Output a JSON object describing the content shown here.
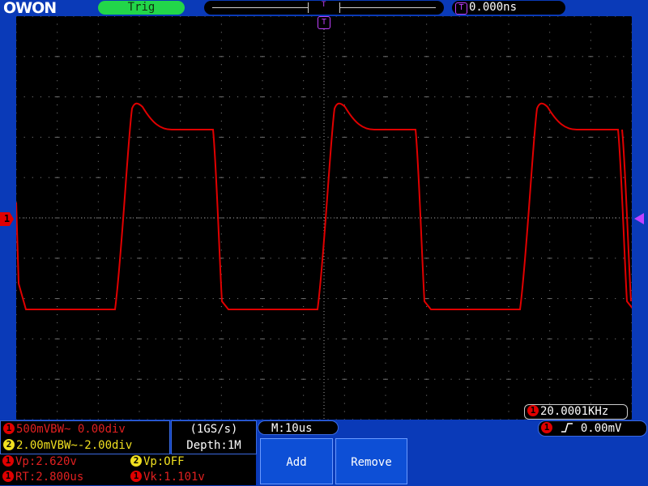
{
  "header": {
    "logo": "OWON",
    "trigger_status": "Trig",
    "timeline_marker": "T",
    "trigger_position_badge": "T",
    "trigger_position": "0.000ns"
  },
  "screen": {
    "ch1_marker": "1",
    "trigger_top_badge": "T",
    "frequency_channel": "1",
    "frequency": "20.0001KHz"
  },
  "channels": {
    "ch1": {
      "badge": "1",
      "setting": "500mVBW~ 0.00div"
    },
    "ch2": {
      "badge": "2",
      "setting": "2.00mVBW~-2.00div"
    }
  },
  "acquisition": {
    "sample_rate": "(1GS/s)",
    "depth": "Depth:1M"
  },
  "timebase": {
    "label": "M:10us"
  },
  "trigger": {
    "badge": "1",
    "slope_icon": "rising-edge",
    "level": "0.00mV"
  },
  "measurements": {
    "vp1": {
      "badge": "1",
      "text": "Vp:2.620v"
    },
    "vp2": {
      "badge": "2",
      "text": "Vp:OFF"
    },
    "rt1": {
      "badge": "1",
      "text": "RT:2.800us"
    },
    "vk1": {
      "badge": "1",
      "text": "Vk:1.101v"
    }
  },
  "menu": {
    "add_label": "Add",
    "remove_label": "Remove"
  },
  "colors": {
    "ch1": "#e00000",
    "ch2": "#f0e020",
    "trigger": "#c040ff",
    "status_ok": "#22d64a",
    "background": "#0a3ab8"
  }
}
